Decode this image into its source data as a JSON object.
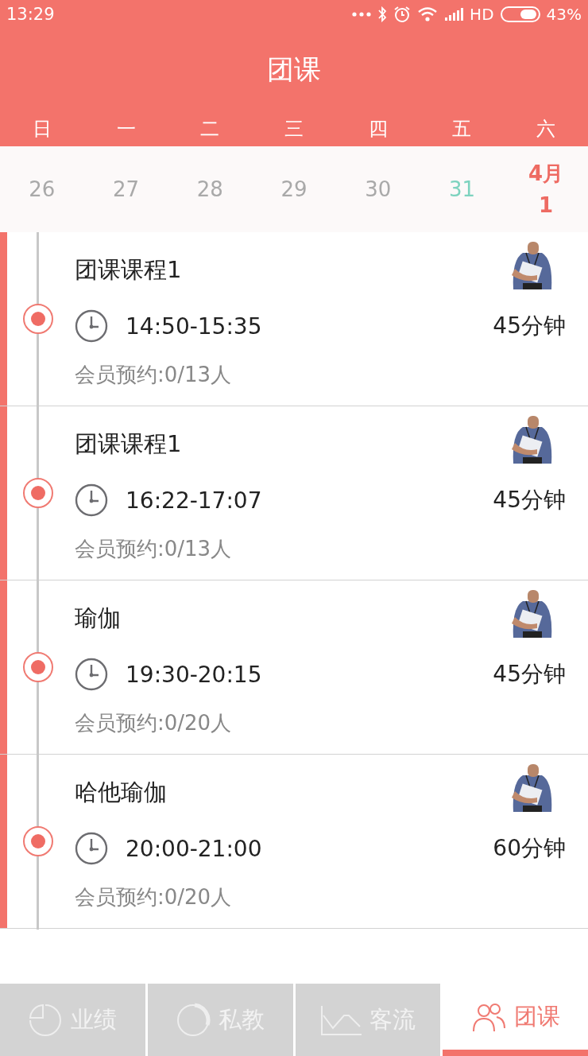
{
  "status_bar": {
    "time": "13:29",
    "network": "HD",
    "battery": "43%"
  },
  "title": "团课",
  "weekdays": [
    "日",
    "一",
    "二",
    "三",
    "四",
    "五",
    "六"
  ],
  "dates": [
    {
      "day": "26",
      "today": false,
      "selected": false
    },
    {
      "day": "27",
      "today": false,
      "selected": false
    },
    {
      "day": "28",
      "today": false,
      "selected": false
    },
    {
      "day": "29",
      "today": false,
      "selected": false
    },
    {
      "day": "30",
      "today": false,
      "selected": false
    },
    {
      "day": "31",
      "today": true,
      "selected": false
    },
    {
      "month": "4月",
      "day": "1",
      "today": false,
      "selected": true
    }
  ],
  "classes": [
    {
      "name": "团课课程1",
      "time": "14:50-15:35",
      "duration": "45分钟",
      "booking": "会员预约:0/13人"
    },
    {
      "name": "团课课程1",
      "time": "16:22-17:07",
      "duration": "45分钟",
      "booking": "会员预约:0/13人"
    },
    {
      "name": "瑜伽",
      "time": "19:30-20:15",
      "duration": "45分钟",
      "booking": "会员预约:0/20人"
    },
    {
      "name": "哈他瑜伽",
      "time": "20:00-21:00",
      "duration": "60分钟",
      "booking": "会员预约:0/20人"
    }
  ],
  "tabs": [
    {
      "kind": "pie",
      "label": "业绩",
      "selected": false
    },
    {
      "kind": "ring",
      "label": "私教",
      "selected": false
    },
    {
      "kind": "line",
      "label": "客流",
      "selected": false
    },
    {
      "kind": "group",
      "label": "团课",
      "selected": true
    }
  ]
}
